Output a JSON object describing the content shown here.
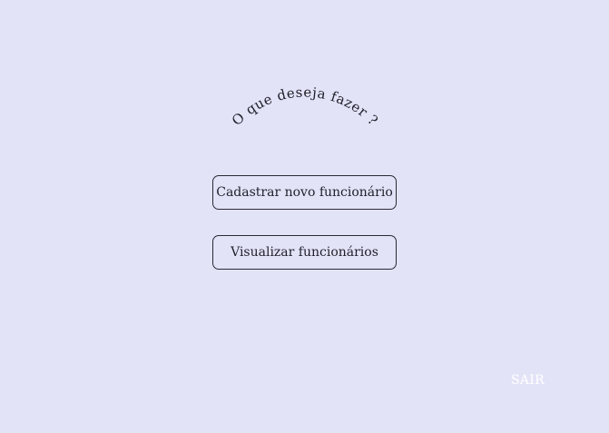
{
  "page": {
    "heading": "O que deseja fazer ?"
  },
  "menu": {
    "register_label": "Cadastrar novo funcionário",
    "view_label": "Visualizar funcionários"
  },
  "footer": {
    "exit_label": "SAIR"
  },
  "colors": {
    "background": "#e3e3f8",
    "text": "#1f1f2a",
    "border": "#2a2a35",
    "exit_text": "#ffffff"
  }
}
